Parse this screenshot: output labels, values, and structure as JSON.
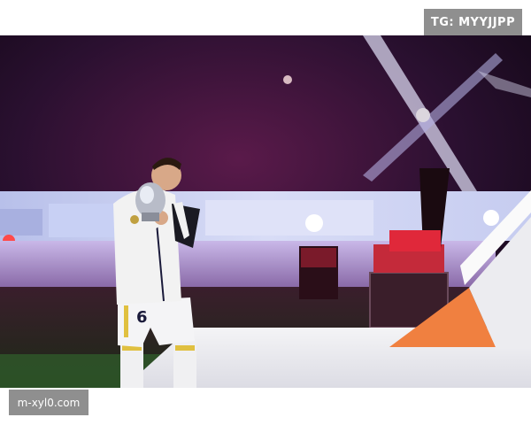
{
  "watermarks": {
    "top": "TG: MYYJJPP",
    "bottom": "m-xyl0.com"
  },
  "photo": {
    "subject": "player-kissing-trophy",
    "jersey_number": "6"
  },
  "colors": {
    "crowd_dark": "#2a1030",
    "stage_light": "#ff3a5a",
    "floodlight_beam": "#e8e8ff",
    "jersey": "#f2f2f2",
    "stage_orange": "#f08040",
    "watermark_bg": "#8f8f8f"
  }
}
